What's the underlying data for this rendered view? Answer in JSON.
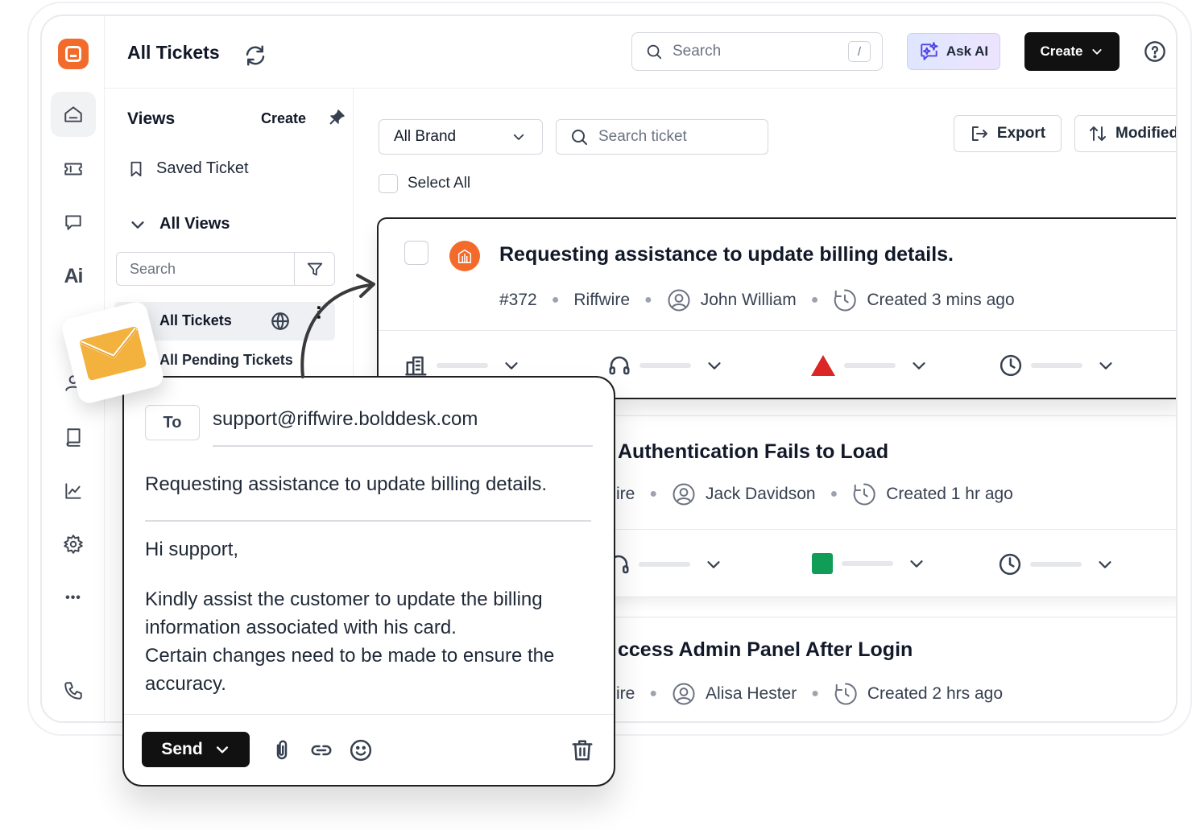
{
  "header": {
    "title": "All Tickets",
    "search_placeholder": "Search",
    "search_shortcut": "/",
    "ask_ai_label": "Ask AI",
    "create_label": "Create"
  },
  "rail": {
    "items": [
      "home-icon",
      "ticket-icon",
      "chat-icon",
      "ai-icon",
      "calendar-icon",
      "contact-icon",
      "book-icon",
      "chart-icon",
      "gear-icon",
      "more-icon",
      "phone-icon"
    ],
    "ai_text": "Ai",
    "more_text": "•••"
  },
  "views": {
    "title": "Views",
    "create_label": "Create",
    "saved_label": "Saved Ticket",
    "all_views_label": "All Views",
    "search_placeholder": "Search",
    "items": [
      {
        "label": "All Tickets",
        "active": true
      },
      {
        "label": "All Pending Tickets",
        "active": false
      }
    ]
  },
  "toolbar": {
    "brand_label": "All Brand",
    "search_placeholder": "Search ticket",
    "export_label": "Export",
    "sort_label": "Modified",
    "select_all_label": "Select All"
  },
  "tickets": [
    {
      "title": "Requesting assistance to update billing details.",
      "id": "#372",
      "brand": "Riffwire",
      "agent": "John William",
      "created": "Created 3 mins ago",
      "priority_color": "#dc2626"
    },
    {
      "title": "Authentication Fails to Load",
      "brand": "ire",
      "agent": "Jack Davidson",
      "created": "Created 1 hr ago",
      "priority_color": "#0f9d58"
    },
    {
      "title": "ccess Admin Panel After Login",
      "brand": "ire",
      "agent": "Alisa Hester",
      "created": "Created 2 hrs ago"
    }
  ],
  "compose": {
    "to_label": "To",
    "to_address": "support@riffwire.bolddesk.com",
    "subject": "Requesting assistance to update billing details.",
    "greeting": "Hi support,",
    "body_lines": [
      "Kindly assist the customer to update the billing",
      "information associated with his card.",
      "Certain changes need to be made to ensure the",
      "accuracy."
    ],
    "send_label": "Send"
  },
  "colors": {
    "brand_orange": "#f26b2a",
    "primary_dark": "#111111",
    "envelope_yellow": "#f3b13d"
  }
}
